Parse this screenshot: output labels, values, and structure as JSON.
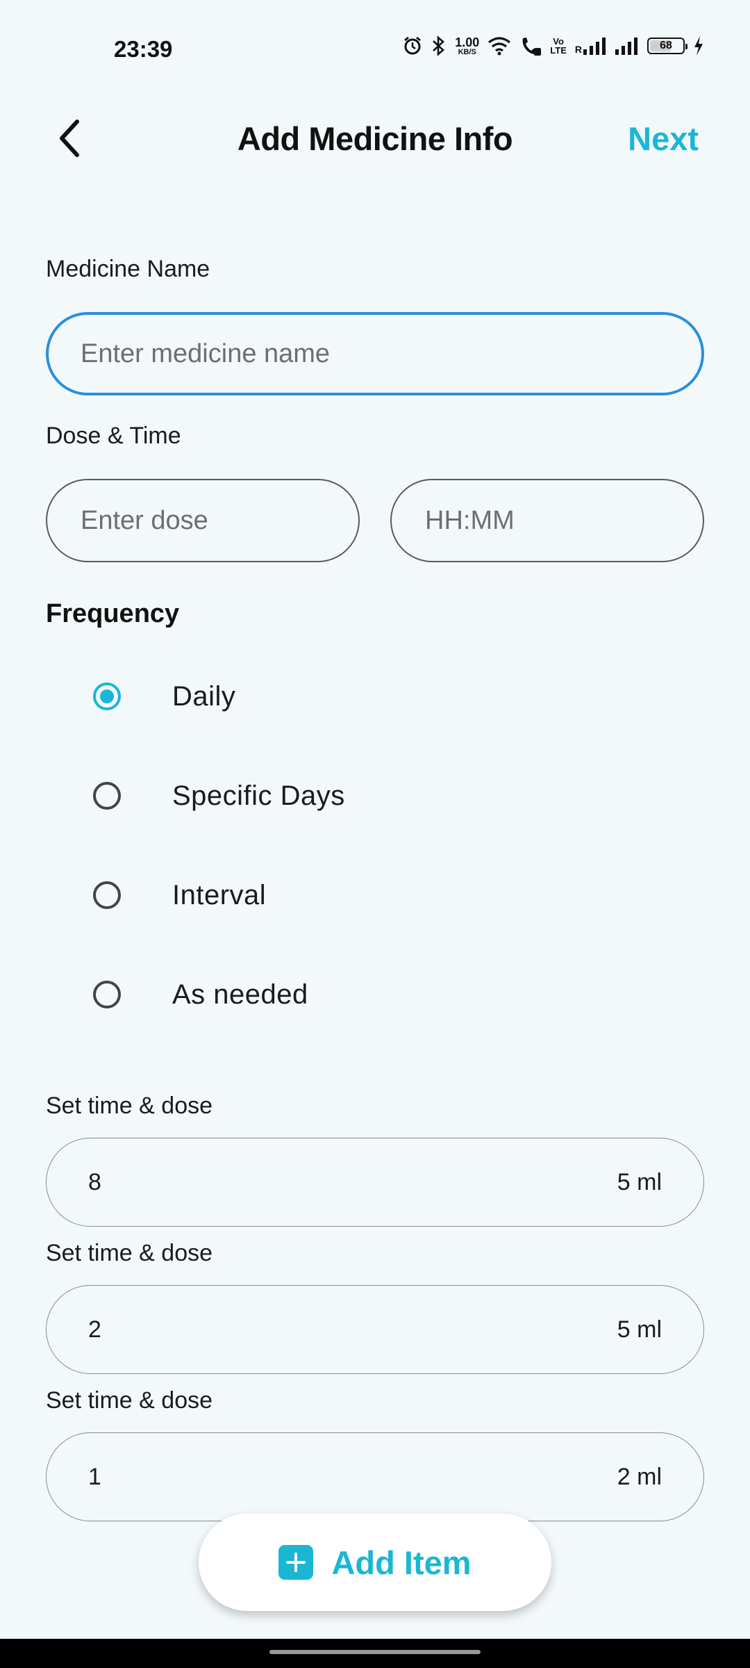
{
  "status_bar": {
    "time": "23:39",
    "net_speed_value": "1.00",
    "net_speed_unit": "KB/S",
    "volte_top": "Vo",
    "volte_bottom": "LTE",
    "roaming": "R",
    "battery_percent": "68",
    "battery_level": 0.68,
    "icons": [
      "alarm-icon",
      "bluetooth-icon",
      "wifi-icon",
      "wifi-calling-icon",
      "signal-icon",
      "signal-icon",
      "charging-icon"
    ]
  },
  "header": {
    "title": "Add Medicine Info",
    "next_label": "Next",
    "back_icon": "chevron-left-icon"
  },
  "form": {
    "medicine_name_label": "Medicine Name",
    "medicine_name_placeholder": "Enter medicine name",
    "medicine_name_value": "",
    "dose_time_label": "Dose & Time",
    "dose_placeholder": "Enter dose",
    "time_placeholder": "HH:MM",
    "frequency_label": "Frequency",
    "frequency_options": [
      {
        "label": "Daily",
        "selected": true
      },
      {
        "label": "Specific Days",
        "selected": false
      },
      {
        "label": "Interval",
        "selected": false
      },
      {
        "label": "As needed",
        "selected": false
      }
    ],
    "time_dose_entries": [
      {
        "label": "Set time & dose",
        "time": "8",
        "dose": "5 ml"
      },
      {
        "label": "Set time & dose",
        "time": "2",
        "dose": "5 ml"
      },
      {
        "label": "Set time & dose",
        "time": "1",
        "dose": "2 ml"
      }
    ]
  },
  "add_item": {
    "label": "Add Item",
    "icon": "plus-square-icon"
  },
  "colors": {
    "accent": "#1ab7d4",
    "focus_border": "#2a8fdc",
    "background": "#f3f8fb"
  }
}
